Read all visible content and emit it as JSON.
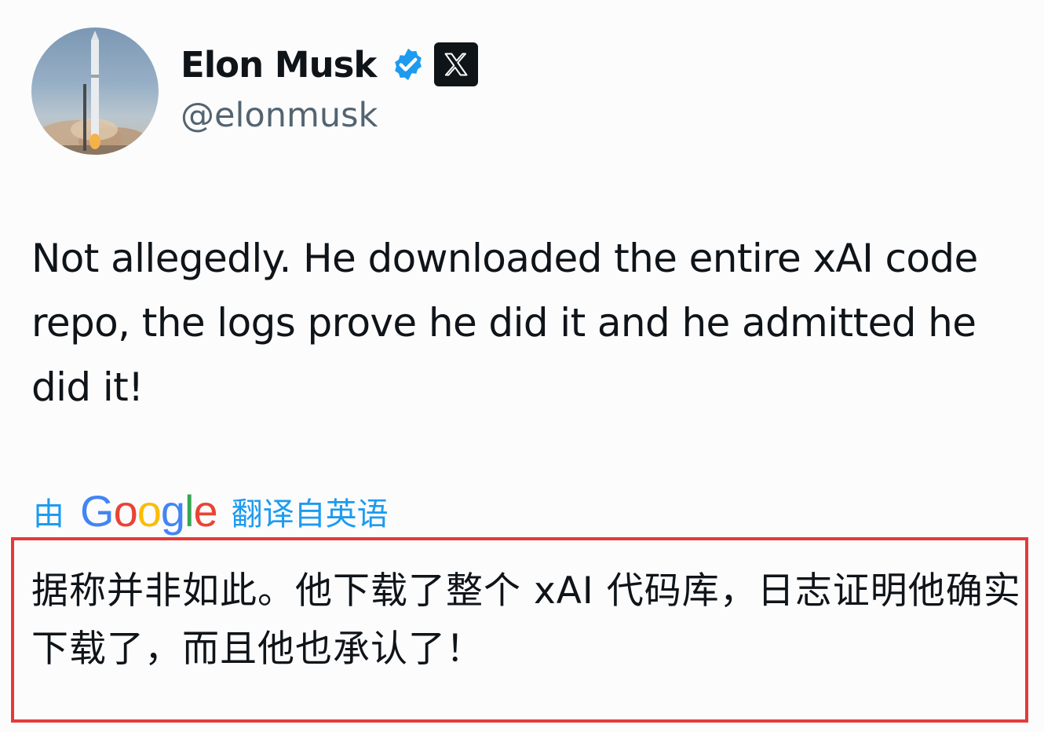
{
  "author": {
    "display_name": "Elon Musk",
    "handle": "@elonmusk",
    "avatar_icon": "rocket-launch-avatar",
    "verified_icon": "verified-badge-icon",
    "affiliation_icon": "x-logo-icon",
    "verified_color": "#1d9bf0"
  },
  "tweet": {
    "text": "Not allegedly. He downloaded the entire xAI code repo, the logs prove he did it and he admitted he did it!"
  },
  "translation": {
    "prefix": "由",
    "provider": {
      "letters": [
        "G",
        "o",
        "o",
        "g",
        "l",
        "e"
      ]
    },
    "suffix": "翻译自英语",
    "text": "据称并非如此。他下载了整个 xAI 代码库，日志证明他确实下载了，而且他也承认了！",
    "link_color": "#1d9bf0",
    "highlight_border_color": "#e43a3a"
  }
}
